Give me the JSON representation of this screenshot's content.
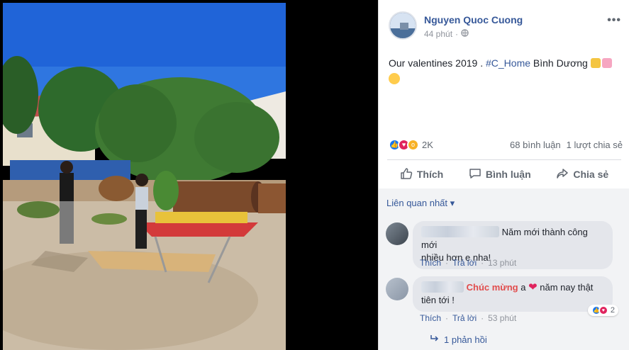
{
  "post": {
    "author": "Nguyen Quoc Cuong",
    "time": "44 phút",
    "privacy_icon": "globe-icon",
    "more_label": "•••",
    "caption_prefix": "Our valentines 2019 . ",
    "hashtag": "#C_Home",
    "location_text": " Bình Dương "
  },
  "stats": {
    "reaction_count": "2K",
    "comments": "68 bình luận",
    "shares": "1 lượt chia sẻ",
    "reactions": [
      "like",
      "love",
      "wow"
    ]
  },
  "actions": {
    "like": "Thích",
    "comment": "Bình luận",
    "share": "Chia sẻ"
  },
  "comments_section": {
    "sort_label": "Liên quan nhất",
    "comments": [
      {
        "text_line1": "Năm mới thành công mới",
        "text_line2": "nhiều hơn e nha!",
        "like": "Thích",
        "reply": "Trả lời",
        "time": "13 phút"
      },
      {
        "mention": "Chúc mừng",
        "text_a": " a ",
        "text_b": " năm nay thật",
        "text_line2": "tiên tới !",
        "like": "Thích",
        "reply": "Trả lời",
        "time": "53 phút",
        "reaction_count": "2"
      }
    ],
    "replies_label": "1 phản hồi"
  },
  "colors": {
    "link": "#365899",
    "like_blue": "#1877f2",
    "love_red": "#e0245e",
    "mention_red": "#e14c4c"
  }
}
